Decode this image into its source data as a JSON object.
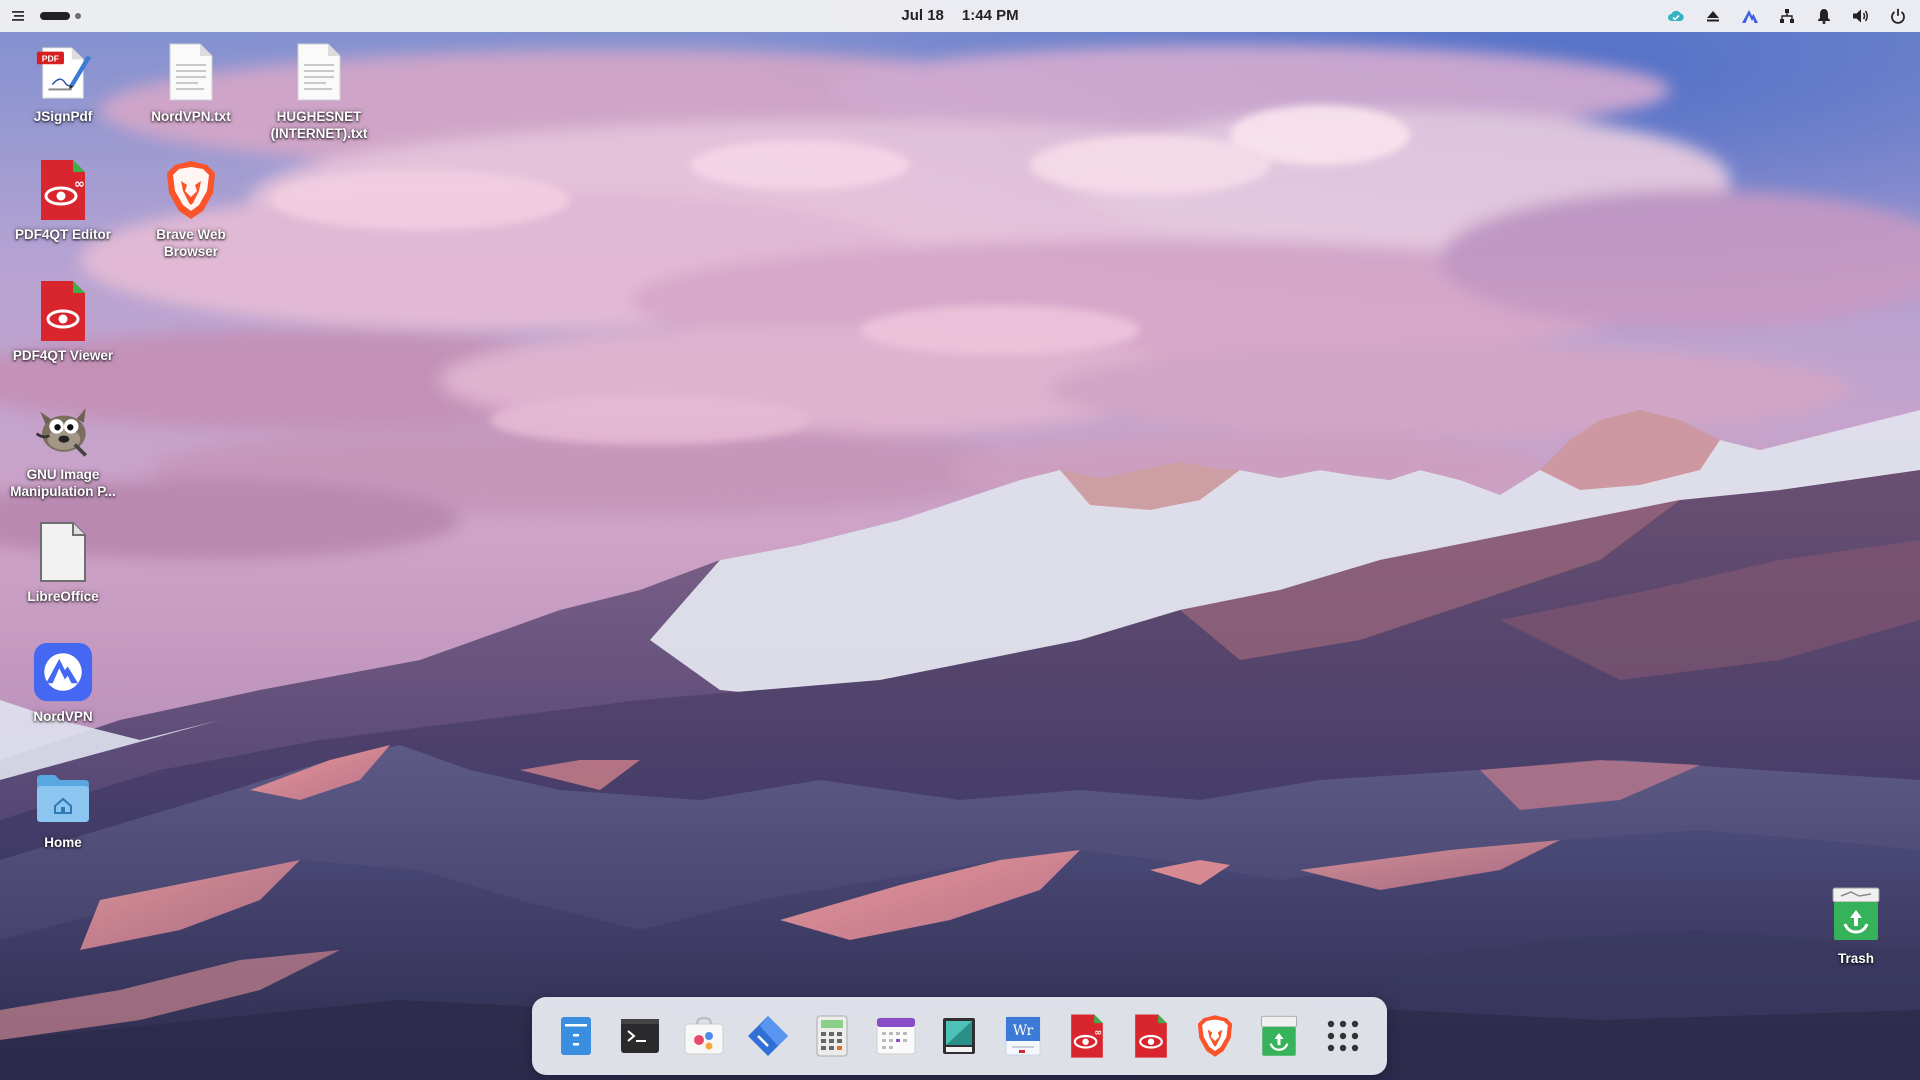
{
  "topbar": {
    "date": "Jul 18",
    "time": "1:44 PM",
    "icons": [
      "menu-icon",
      "workspace-indicator",
      "cloud-sync-icon",
      "eject-icon",
      "nordvpn-tray-icon",
      "network-icon",
      "notification-bell-icon",
      "volume-icon",
      "power-icon"
    ]
  },
  "desktop": {
    "icons": [
      {
        "name": "JSignPdf",
        "icon": "pdf-signature-icon"
      },
      {
        "name": "NordVPN.txt",
        "icon": "text-file-icon"
      },
      {
        "name": "HUGHESNET (INTERNET).txt",
        "icon": "text-file-icon"
      },
      {
        "name": "PDF4QT Editor",
        "icon": "pdf-editor-icon"
      },
      {
        "name": "Brave Web Browser",
        "icon": "brave-lion-icon"
      },
      {
        "name": "PDF4QT Viewer",
        "icon": "pdf-viewer-icon"
      },
      {
        "name": "GNU Image Manipulation P...",
        "icon": "gimp-icon"
      },
      {
        "name": "LibreOffice",
        "icon": "document-icon"
      },
      {
        "name": "NordVPN",
        "icon": "nordvpn-icon"
      },
      {
        "name": "Home",
        "icon": "home-folder-icon"
      },
      {
        "name": "Trash",
        "icon": "trash-icon"
      }
    ]
  },
  "dock": {
    "items": [
      "file-manager-icon",
      "terminal-icon",
      "app-store-icon",
      "code-editor-icon",
      "calculator-icon",
      "calendar-icon",
      "screenshot-icon",
      "word-processor-icon",
      "pdf-editor-icon",
      "pdf-viewer-icon",
      "brave-lion-icon",
      "trash-icon",
      "app-grid-icon"
    ]
  },
  "colors": {
    "topbar_bg": "#efeff2",
    "dock_bg": "#eceef4",
    "sky_top": "#5f79c4",
    "cloud_pink": "#e9b9d4",
    "mountain_purple": "#3f3c6e",
    "dune_pink": "#d98a90"
  }
}
